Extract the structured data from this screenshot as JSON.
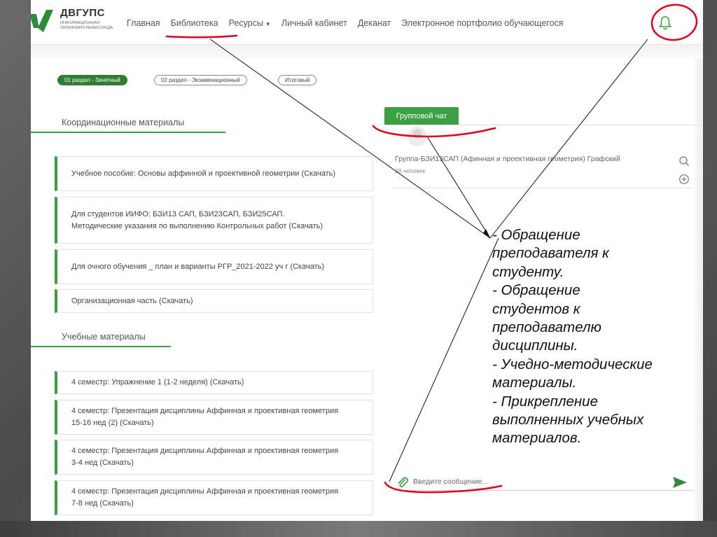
{
  "header": {
    "logo_title": "ДВГУПС",
    "logo_subtitle": "информационная образовательная среда",
    "nav": [
      {
        "label": "Главная"
      },
      {
        "label": "Библиотека"
      },
      {
        "label": "Ресурсы",
        "caret": "▼"
      },
      {
        "label": "Личный кабинет"
      },
      {
        "label": "Деканат"
      },
      {
        "label": "Электронное портфолио обучающегося"
      }
    ]
  },
  "tabs": [
    {
      "label": "01 раздел - Зачетный",
      "active": true
    },
    {
      "label": "02 раздел - Экзаменационный",
      "active": false
    },
    {
      "label": "Итоговый",
      "active": false
    }
  ],
  "coordination": {
    "title": "Координационные материалы",
    "items": [
      {
        "text": "Учебное пособие: Основы аффинной и проективной геометрии (Скачать)"
      },
      {
        "text": "Для студентов ИИФО: БЗИ13 САП, БЗИ23САП, БЗИ25САП. Методические указания по выполнению Контрольных работ (Скачать)"
      },
      {
        "text": "Для очного обучения _ план и варианты РГР_2021-2022 уч г (Скачать)"
      },
      {
        "text": "Организационная часть (Скачать)"
      }
    ]
  },
  "study": {
    "title": "Учебные материалы",
    "items": [
      {
        "text": "4 семестр: Упражнение 1 (1-2 неделя) (Скачать)"
      },
      {
        "text": "4 семестр: Презентация дисциплины Аффинная и проективная геометрия 15-16 нед (2) (Скачать)"
      },
      {
        "text": "4 семестр: Презентация дисциплины Аффинная и проективная геометрия 3-4 нед (Скачать)"
      },
      {
        "text": "4 семестр: Презентация дисциплины Аффинная и проективная геометрия 7-8 нед (Скачать)"
      }
    ]
  },
  "chat": {
    "tab_label": "Групповой чат",
    "group_name": "Группа-БЗИ13САП (Афинная и проективная геометрия) Графский",
    "group_count": "26 человек",
    "message_placeholder": "Введите сообщение..."
  },
  "annotation": {
    "lines": [
      "- Обращение",
      "преподавателя к",
      "студенту.",
      "- Обращение",
      "студентов к",
      "преподавателю",
      "дисциплины.",
      "- Учедно-методические",
      "материалы.",
      "- Прикрепление",
      "выполненных учебных",
      "материалов."
    ]
  },
  "colors": {
    "accent": "#3aa043",
    "tab_active": "#2e7d32",
    "markup_red": "#e0001a"
  },
  "icons": [
    "logo-mark-icon",
    "bell-icon",
    "search-icon",
    "add-circle-icon",
    "paperclip-icon",
    "send-icon"
  ]
}
